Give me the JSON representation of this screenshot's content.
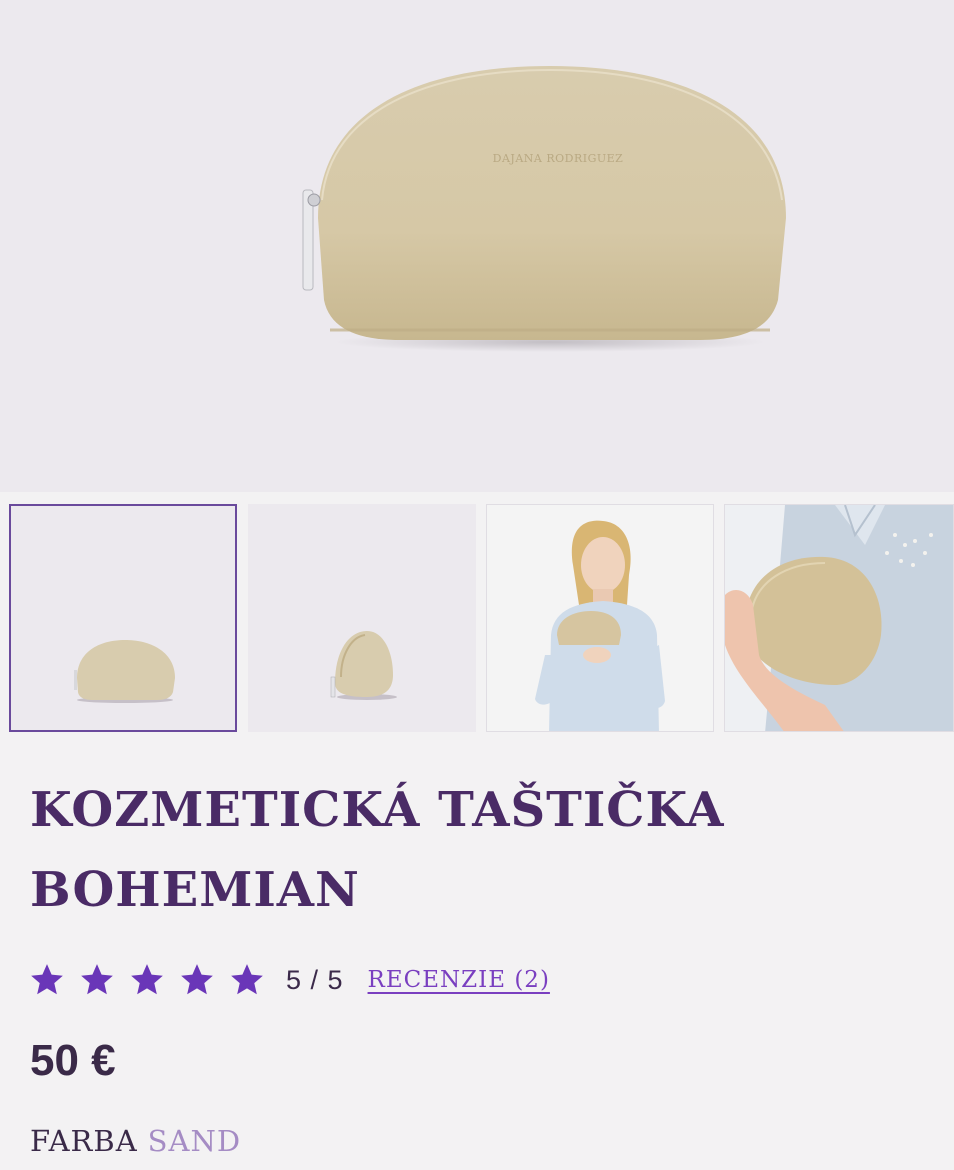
{
  "product": {
    "title": "KOZMETICKÁ TAŠTIČKA BOHEMIAN",
    "brand_logo_text": "DAJANA RODRIGUEZ",
    "rating": {
      "stars_filled": 5,
      "stars_total": 5,
      "score_text": "5 / 5",
      "reviews_link": "RECENZIE (2)"
    },
    "price": "50 €",
    "color": {
      "label": "FARBA",
      "value": "SAND"
    }
  },
  "gallery": {
    "active_index": 0,
    "thumbnails": [
      {
        "name": "front-view"
      },
      {
        "name": "side-view"
      },
      {
        "name": "model-holding"
      },
      {
        "name": "closeup-holding"
      }
    ]
  },
  "colors": {
    "accent_purple": "#7a3fc0",
    "title_purple": "#4a2b66",
    "bag_gold": "#d9cbab",
    "star": "#6a36b8"
  }
}
